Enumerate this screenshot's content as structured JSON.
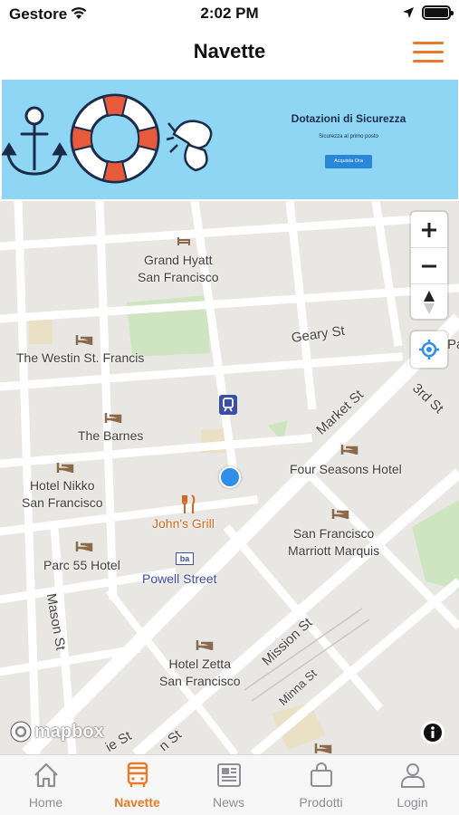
{
  "status_bar": {
    "carrier": "Gestore",
    "time": "2:02 PM"
  },
  "nav": {
    "title": "Navette",
    "menu_icon": "hamburger-menu-icon"
  },
  "banner": {
    "title": "Dotazioni di Sicurezza",
    "subtitle": "Sicurezza al primo posto",
    "button": "Acquista Ora"
  },
  "map": {
    "labels": {
      "grand_hyatt": "Grand Hyatt\nSan Francisco",
      "westin": "The Westin St. Francis",
      "barnes": "The Barnes",
      "nikko": "Hotel Nikko\nSan Francisco",
      "johns_grill": "John's Grill",
      "parc55": "Parc 55 Hotel",
      "powell": "Powell Street",
      "four_seasons": "Four Seasons Hotel",
      "marriott": "San Francisco\nMarriott Marquis",
      "zetta": "Hotel Zetta\nSan Francisco"
    },
    "streets": {
      "geary": "Geary St",
      "market": "Market St",
      "third": "3rd St",
      "mason": "Mason St",
      "mission": "Mission St",
      "minna": "Minna St",
      "bottom_left": "ie St",
      "bottom_mid": "n St",
      "right_edge": "Pa"
    },
    "attribution": "mapbox"
  },
  "tabs": [
    {
      "label": "Home",
      "icon": "home-icon",
      "active": false
    },
    {
      "label": "Navette",
      "icon": "bus-icon",
      "active": true
    },
    {
      "label": "News",
      "icon": "newspaper-icon",
      "active": false
    },
    {
      "label": "Prodotti",
      "icon": "shopping-bag-icon",
      "active": false
    },
    {
      "label": "Login",
      "icon": "user-icon",
      "active": false
    }
  ],
  "colors": {
    "accent": "#e87a2a",
    "banner_bg": "#8fd6f5",
    "user_dot": "#2e8ee8",
    "poi_orange": "#d9661f",
    "transit_blue": "#3b4ea6"
  }
}
